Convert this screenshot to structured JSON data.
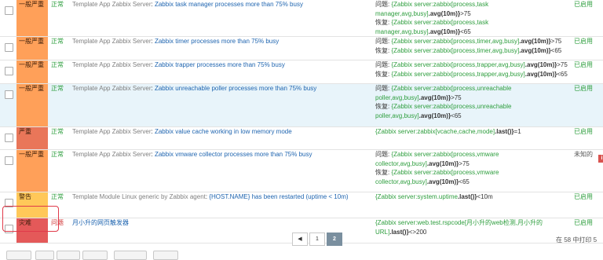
{
  "rows": [
    {
      "severity": "一般严重",
      "status": "正常",
      "template": "Template App Zabbix Server",
      "name": "Zabbix task manager processes more than 75% busy",
      "expr": [
        {
          "label": "问题: ",
          "host": "{Zabbix server:zabbix[process,task manager,avg,busy]",
          "func": ".avg(10m)}",
          "rest": ">75"
        },
        {
          "label": "恢复: ",
          "host": "{Zabbix server:zabbix[process,task manager,avg,busy]",
          "func": ".avg(10m)}",
          "rest": "<65"
        }
      ],
      "enabled": "已启用"
    },
    {
      "severity": "一般严重",
      "status": "正常",
      "template": "Template App Zabbix Server",
      "name": "Zabbix timer processes more than 75% busy",
      "expr": [
        {
          "label": "问题: ",
          "host": "{Zabbix server:zabbix[process,timer,avg,busy]",
          "func": ".avg(10m)}",
          "rest": ">75"
        },
        {
          "label": "恢复: ",
          "host": "{Zabbix server:zabbix[process,timer,avg,busy]",
          "func": ".avg(10m)}",
          "rest": "<65"
        }
      ],
      "enabled": "已启用"
    },
    {
      "severity": "一般严重",
      "status": "正常",
      "template": "Template App Zabbix Server",
      "name": "Zabbix trapper processes more than 75% busy",
      "expr": [
        {
          "label": "问题: ",
          "host": "{Zabbix server:zabbix[process,trapper,avg,busy]",
          "func": ".avg(10m)}",
          "rest": ">75"
        },
        {
          "label": "恢复: ",
          "host": "{Zabbix server:zabbix[process,trapper,avg,busy]",
          "func": ".avg(10m)}",
          "rest": "<65"
        }
      ],
      "enabled": "已启用"
    },
    {
      "severity": "一般严重",
      "status": "正常",
      "template": "Template App Zabbix Server",
      "name": "Zabbix unreachable poller processes more than 75% busy",
      "expr": [
        {
          "label": "问题: ",
          "host": "{Zabbix server:zabbix[process,unreachable poller,avg,busy]",
          "func": ".avg(10m)}",
          "rest": ">75"
        },
        {
          "label": "恢复: ",
          "host": "{Zabbix server:zabbix[process,unreachable poller,avg,busy]",
          "func": ".avg(10m)}",
          "rest": "<65"
        }
      ],
      "enabled": "已启用"
    },
    {
      "severity": "严重",
      "status": "正常",
      "template": "Template App Zabbix Server",
      "name": "Zabbix value cache working in low memory mode",
      "expr": [
        {
          "label": "",
          "host": "{Zabbix server:zabbix[vcache,cache,mode]",
          "func": ".last()}",
          "rest": "=1"
        }
      ],
      "enabled": "已启用"
    },
    {
      "severity": "一般严重",
      "status": "正常",
      "template": "Template App Zabbix Server",
      "name": "Zabbix vmware collector processes more than 75% busy",
      "expr": [
        {
          "label": "问题: ",
          "host": "{Zabbix server:zabbix[process,vmware collector,avg,busy]",
          "func": ".avg(10m)}",
          "rest": ">75"
        },
        {
          "label": "恢复: ",
          "host": "{Zabbix server:zabbix[process,vmware collector,avg,busy]",
          "func": ".avg(10m)}",
          "rest": "<65"
        }
      ],
      "enabled": "未知的"
    },
    {
      "severity": "警告",
      "status": "正常",
      "template": "Template Module Linux generic by Zabbix agent",
      "name": "{HOST.NAME} has been restarted (uptime < 10m)",
      "expr": [
        {
          "label": "",
          "host": "{Zabbix server:system.uptime",
          "func": ".last()}",
          "rest": "<10m"
        }
      ],
      "enabled": "已启用"
    },
    {
      "severity": "灾难",
      "status": "问题",
      "template": "",
      "name": "月小升的网页触发器",
      "expr": [
        {
          "label": "",
          "host": "{Zabbix server:web.test.rspcode[月小升的web检测,月小升的URL]",
          "func": ".last()}",
          "rest": "<>200"
        }
      ],
      "enabled": "已启用"
    }
  ],
  "pager": {
    "prev": "◀",
    "pages": [
      "1",
      "2"
    ],
    "current": "2"
  },
  "count_text": "在 58 中打印 5",
  "info_badge": "i"
}
